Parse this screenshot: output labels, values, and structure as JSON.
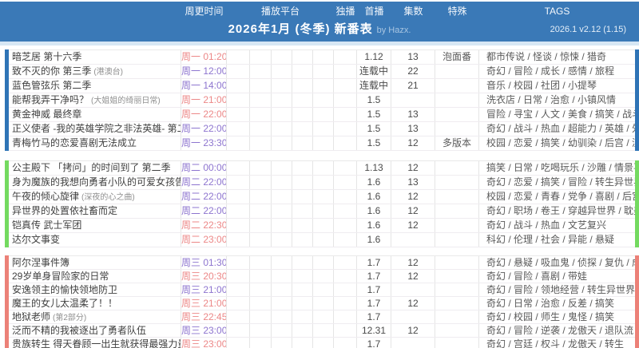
{
  "header": {
    "columns": [
      "周更时间",
      "播放平台",
      "独播",
      "首播",
      "集数",
      "特殊",
      "TAGS"
    ],
    "title": "2026年1月 (冬季) 新番表",
    "by": "by Hazx.",
    "version": "2026.1 v2.12  (1.15)"
  },
  "colors": {
    "header_bg": "#3a79b7",
    "header_strip": "#d7e7f4",
    "time_red": "#ec8787",
    "time_purple": "#8d74cf",
    "bar_monday": "#2f74b6",
    "bar_tuesday": "#74da60",
    "bar_wednesday": "#ec8178"
  },
  "blocks": [
    {
      "day": "周一",
      "bar_color": "#2f74b6",
      "rows": [
        {
          "title": "暗芝居 第十六季",
          "time": "周一 01:20",
          "time_color": "red",
          "premiere": "1.12",
          "eps": "13",
          "special": "泡面番",
          "tags": "都市传说 / 怪谈 / 惊悚 / 猎奇"
        },
        {
          "title": "致不灭的你 第三季",
          "note": "(港澳台)",
          "time": "周一 12:00",
          "time_color": "purple",
          "premiere": "连载中",
          "eps": "22",
          "special": "",
          "tags": "奇幻 / 冒险 / 成长 / 感情 / 旅程"
        },
        {
          "title": "蓝色管弦乐 第二季",
          "time": "周一 14:00",
          "time_color": "purple",
          "premiere": "连载中",
          "eps": "21",
          "special": "",
          "tags": "音乐 / 校园 / 社团 / 小提琴"
        },
        {
          "title": "能帮我弄干净吗？",
          "note": "(大姐姐的绮丽日常)",
          "time": "周一 21:00",
          "time_color": "red",
          "premiere": "1.5",
          "eps": "",
          "special": "",
          "tags": "洗衣店 / 日常 / 治愈 / 小镇风情"
        },
        {
          "title": "黄金神威 最终章",
          "time": "周一 22:00",
          "time_color": "red",
          "premiere": "1.5",
          "eps": "13",
          "special": "",
          "tags": "冒险 / 寻宝 / 人文 / 美食 / 搞笑 / 战斗"
        },
        {
          "title": "正义使者 -我的英雄学院之非法英雄- 第二季",
          "time": "周一 22:00",
          "time_color": "purple",
          "premiere": "1.5",
          "eps": "13",
          "special": "",
          "tags": "奇幻 / 战斗 / 热血 / 超能力 / 英雄 / 外传"
        },
        {
          "title": "青梅竹马的恋爱喜剧无法成立",
          "time": "周一 23:30",
          "time_color": "purple",
          "premiere": "1.5",
          "eps": "12",
          "special": "多版本",
          "tags": "校园 / 恋爱 / 搞笑 / 幼驯染 / 后宫 / 涩涩"
        }
      ]
    },
    {
      "day": "周二",
      "bar_color": "#74da60",
      "rows": [
        {
          "title": "公主殿下 「拷问」的时间到了 第二季",
          "time": "周二 00:00",
          "time_color": "purple",
          "premiere": "1.13",
          "eps": "12",
          "special": "",
          "tags": "搞笑 / 日常 / 吃喝玩乐 / 沙雕 / 情景喜剧"
        },
        {
          "title": "身为魔族的我想向勇者小队的可爱女孩告白",
          "time": "周二 22:00",
          "time_color": "purple",
          "premiere": "1.6",
          "eps": "13",
          "special": "",
          "tags": "奇幻 / 恋爱 / 搞笑 / 冒险 / 转生异世界"
        },
        {
          "title": "午夜的倾心旋律",
          "note": "(深夜的心之曲)",
          "time": "周二 22:00",
          "time_color": "purple",
          "premiere": "1.6",
          "eps": "12",
          "special": "",
          "tags": "校园 / 恋爱 / 青春 / 党争 / 喜剧 / 后宫"
        },
        {
          "title": "异世界的处置依社畜而定",
          "time": "周二 22:00",
          "time_color": "purple",
          "premiere": "1.6",
          "eps": "12",
          "special": "",
          "tags": "奇幻 / 职场 / 卷王 / 穿越异世界 / 耽美"
        },
        {
          "title": "铠真传 武士军团",
          "time": "周二 22:30",
          "time_color": "red",
          "premiere": "1.6",
          "eps": "12",
          "special": "",
          "tags": "奇幻 / 战斗 / 热血 / 文艺复兴"
        },
        {
          "title": "达尔文事变",
          "time": "周二 23:00",
          "time_color": "red",
          "premiere": "1.6",
          "eps": "",
          "special": "",
          "tags": "科幻 / 伦理 / 社会 / 异能 / 悬疑"
        }
      ]
    },
    {
      "day": "周三",
      "bar_color": "#ec8178",
      "rows": [
        {
          "title": "阿尔涅事件簿",
          "time": "周三 01:30",
          "time_color": "purple",
          "premiere": "1.7",
          "eps": "12",
          "special": "",
          "tags": "奇幻 / 悬疑 / 吸血鬼 / 侦探 / 复仇 / 成长"
        },
        {
          "title": "29岁单身冒险家的日常",
          "time": "周三 20:30",
          "time_color": "red",
          "premiere": "1.7",
          "eps": "12",
          "special": "",
          "tags": "奇幻 / 冒险 / 喜剧 / 带娃"
        },
        {
          "title": "安逸领主的愉快领地防卫",
          "time": "周三 21:00",
          "time_color": "purple",
          "premiere": "1.7",
          "eps": "",
          "special": "",
          "tags": "奇幻 / 冒险 / 领地经营 / 转生异世界"
        },
        {
          "title": "魔王的女儿太温柔了！！",
          "time": "周三 21:00",
          "time_color": "red",
          "premiere": "1.7",
          "eps": "12",
          "special": "",
          "tags": "奇幻 / 日常 / 治愈 / 反差 / 搞笑"
        },
        {
          "title": "地狱老师",
          "note": "(第2部分)",
          "time": "周三 22:45",
          "time_color": "red",
          "premiere": "1.7",
          "eps": "",
          "special": "",
          "tags": "奇幻 / 校园 / 师生 / 鬼怪 / 搞笑"
        },
        {
          "title": "泛而不精的我被逐出了勇者队伍",
          "time": "周三 23:00",
          "time_color": "purple",
          "premiere": "12.31",
          "eps": "12",
          "special": "",
          "tags": "奇幻 / 冒险 / 逆袭 / 龙傲天 / 退队流"
        },
        {
          "title": "贵族转生 得天眷顾一出生就获得最强力量",
          "time": "周三 23:00",
          "time_color": "red",
          "premiere": "1.7",
          "eps": "",
          "special": "",
          "tags": "奇幻 / 宫廷 / 权斗 / 龙傲天 / 转生"
        }
      ]
    }
  ]
}
